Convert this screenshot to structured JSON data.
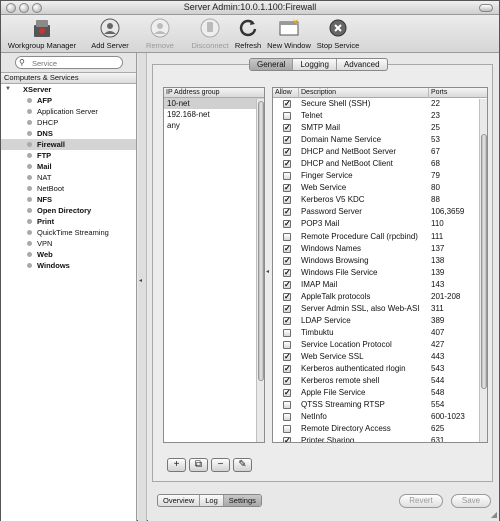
{
  "window": {
    "title": "Server Admin:10.0.1.100:Firewall"
  },
  "toolbar": {
    "workgroup_manager": "Workgroup Manager",
    "add_server": "Add Server",
    "remove_server": "Remove Server",
    "disconnect": "Disconnect",
    "refresh": "Refresh",
    "new_window": "New Window",
    "stop_service": "Stop Service"
  },
  "sidebar": {
    "search_placeholder": "Service",
    "header": "Computers & Services",
    "server": "XServer",
    "items": [
      {
        "label": "AFP"
      },
      {
        "label": "Application Server"
      },
      {
        "label": "DHCP"
      },
      {
        "label": "DNS"
      },
      {
        "label": "Firewall"
      },
      {
        "label": "FTP"
      },
      {
        "label": "Mail"
      },
      {
        "label": "NAT"
      },
      {
        "label": "NetBoot"
      },
      {
        "label": "NFS"
      },
      {
        "label": "Open Directory"
      },
      {
        "label": "Print"
      },
      {
        "label": "QuickTime Streaming"
      },
      {
        "label": "VPN"
      },
      {
        "label": "Web"
      },
      {
        "label": "Windows"
      }
    ]
  },
  "tabs": [
    "General",
    "Logging",
    "Advanced"
  ],
  "ip_groups": {
    "header": "IP Address group",
    "items": [
      "10-net",
      "192.168-net",
      "any"
    ]
  },
  "services": {
    "headers": {
      "allow": "Allow",
      "description": "Description",
      "ports": "Ports"
    },
    "rows": [
      {
        "allow": true,
        "description": "Secure Shell (SSH)",
        "ports": "22"
      },
      {
        "allow": false,
        "description": "Telnet",
        "ports": "23"
      },
      {
        "allow": true,
        "description": "SMTP Mail",
        "ports": "25"
      },
      {
        "allow": true,
        "description": "Domain Name Service",
        "ports": "53"
      },
      {
        "allow": true,
        "description": "DHCP and NetBoot Server",
        "ports": "67"
      },
      {
        "allow": true,
        "description": "DHCP and NetBoot Client",
        "ports": "68"
      },
      {
        "allow": false,
        "description": "Finger Service",
        "ports": "79"
      },
      {
        "allow": true,
        "description": "Web Service",
        "ports": "80"
      },
      {
        "allow": true,
        "description": "Kerberos V5 KDC",
        "ports": "88"
      },
      {
        "allow": true,
        "description": "Password Server",
        "ports": "106,3659"
      },
      {
        "allow": true,
        "description": "POP3 Mail",
        "ports": "110"
      },
      {
        "allow": false,
        "description": "Remote Procedure Call (rpcbind)",
        "ports": "111"
      },
      {
        "allow": true,
        "description": "Windows Names",
        "ports": "137"
      },
      {
        "allow": true,
        "description": "Windows Browsing",
        "ports": "138"
      },
      {
        "allow": true,
        "description": "Windows File Service",
        "ports": "139"
      },
      {
        "allow": true,
        "description": "IMAP Mail",
        "ports": "143"
      },
      {
        "allow": true,
        "description": "AppleTalk protocols",
        "ports": "201-208"
      },
      {
        "allow": true,
        "description": "Server Admin SSL, also Web-ASI",
        "ports": "311"
      },
      {
        "allow": true,
        "description": "LDAP Service",
        "ports": "389"
      },
      {
        "allow": false,
        "description": "Timbuktu",
        "ports": "407"
      },
      {
        "allow": false,
        "description": "Service Location Protocol",
        "ports": "427"
      },
      {
        "allow": true,
        "description": "Web Service SSL",
        "ports": "443"
      },
      {
        "allow": true,
        "description": "Kerberos authenticated rlogin",
        "ports": "543"
      },
      {
        "allow": true,
        "description": "Kerberos remote shell",
        "ports": "544"
      },
      {
        "allow": true,
        "description": "Apple File Service",
        "ports": "548"
      },
      {
        "allow": false,
        "description": "QTSS Streaming RTSP",
        "ports": "554"
      },
      {
        "allow": false,
        "description": "NetInfo",
        "ports": "600-1023"
      },
      {
        "allow": false,
        "description": "Remote Directory Access",
        "ports": "625"
      },
      {
        "allow": true,
        "description": "Printer Sharing",
        "ports": "631"
      }
    ]
  },
  "bottom": {
    "tabs": [
      "Overview",
      "Log",
      "Settings"
    ],
    "revert": "Revert",
    "save": "Save"
  }
}
